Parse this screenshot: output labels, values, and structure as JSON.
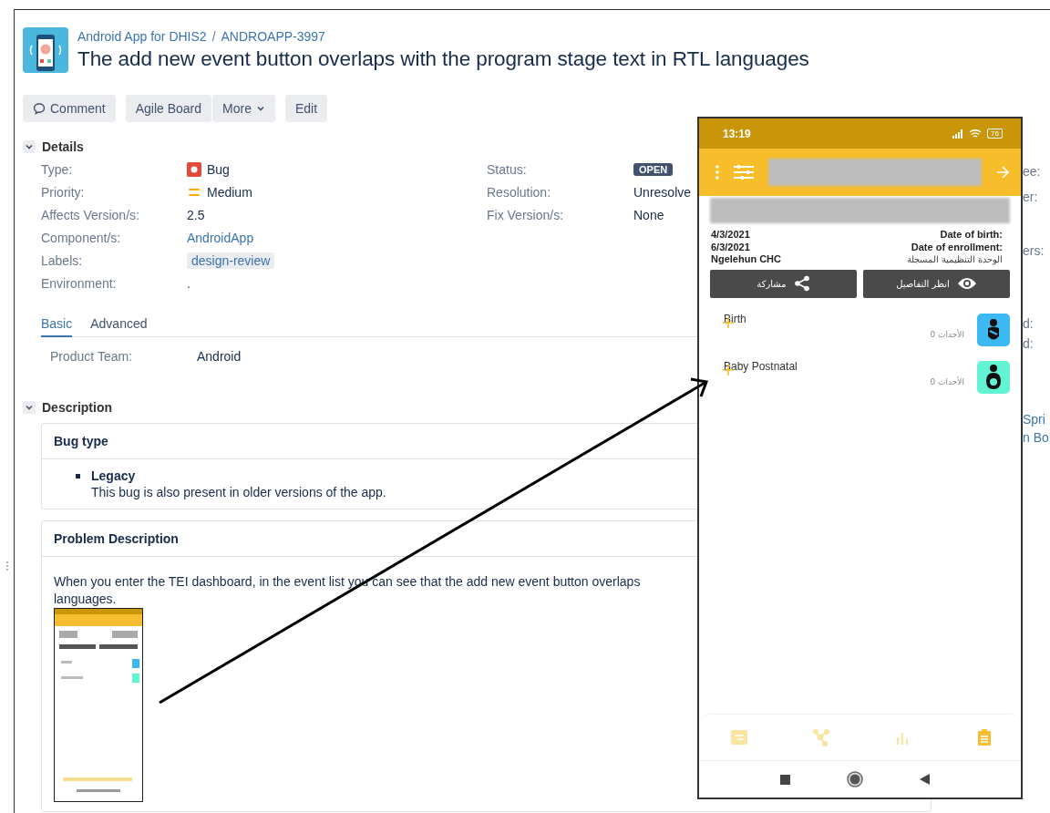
{
  "breadcrumb": {
    "project": "Android App for DHIS2",
    "separator": "/",
    "issue_key": "ANDROAPP-3997"
  },
  "title": "The add new event button overlaps with the program stage text in RTL languages",
  "toolbar": [
    {
      "label": "Comment",
      "kind": "comment"
    },
    {
      "label": "Agile Board",
      "kind": "plain"
    },
    {
      "label": "More",
      "kind": "dropdown"
    },
    {
      "label": "Edit",
      "kind": "plain"
    }
  ],
  "details": {
    "heading": "Details",
    "expanded": true,
    "left_fields": [
      {
        "label": "Type:",
        "value": "Bug",
        "kind": "type"
      },
      {
        "label": "Priority:",
        "value": "Medium",
        "kind": "priority"
      },
      {
        "label": "Affects Version/s:",
        "value": "2.5",
        "kind": "text"
      },
      {
        "label": "Component/s:",
        "value": "AndroidApp",
        "kind": "link"
      },
      {
        "label": "Labels:",
        "value": "design-review",
        "kind": "label"
      },
      {
        "label": "Environment:",
        "value": ".",
        "kind": "text"
      }
    ],
    "right_fields": [
      {
        "label": "Status:",
        "value": "OPEN",
        "kind": "status"
      },
      {
        "label": "Resolution:",
        "value": "Unresolve",
        "kind": "text"
      },
      {
        "label": "Fix Version/s:",
        "value": "None",
        "kind": "text"
      }
    ]
  },
  "tabs": [
    {
      "label": "Basic",
      "selected": true
    },
    {
      "label": "Advanced",
      "selected": false
    }
  ],
  "custom_fields": [
    {
      "label": "Product Team:",
      "value": "Android"
    }
  ],
  "description": {
    "heading": "Description",
    "expanded": true,
    "panels": [
      {
        "title": "Bug type",
        "kind": "list",
        "items": [
          {
            "title": "Legacy",
            "text": "This bug is also present in older versions of the app."
          }
        ]
      },
      {
        "title": "Problem Description",
        "kind": "text",
        "lines": [
          "When you enter the TEI dashboard, in the event list you can see that the add new event button overlaps",
          "languages."
        ]
      }
    ]
  },
  "sidebar_fragments": [
    [
      "ee:",
      "er:"
    ],
    [
      "ers:"
    ],
    [
      "d:",
      "d:"
    ],
    [
      "Spri",
      "n Bo"
    ]
  ],
  "phone": {
    "time": "13:19",
    "battery": "76",
    "info_left": [
      "4/3/2021",
      "6/3/2021",
      "Ngelehun CHC"
    ],
    "info_right": [
      "Date of birth:",
      "Date of enrollment:",
      "الوحدة التنظيمية المسجلة"
    ],
    "actions": [
      {
        "label": "انظر التفاصيل",
        "kind": "view"
      },
      {
        "label": "مشاركة",
        "kind": "share"
      }
    ],
    "stages": [
      {
        "name": "Birth",
        "count": "0 الأحداث",
        "color": "#3cb8f2",
        "kind": "baby"
      },
      {
        "name": "Baby Postnatal",
        "count": "0 الأحداث",
        "color": "#62f2d4",
        "kind": "mother"
      }
    ],
    "nav": [
      {
        "kind": "notes",
        "selected": false
      },
      {
        "kind": "relationships",
        "selected": false
      },
      {
        "kind": "analytics",
        "selected": false
      },
      {
        "kind": "events",
        "selected": true
      }
    ]
  }
}
